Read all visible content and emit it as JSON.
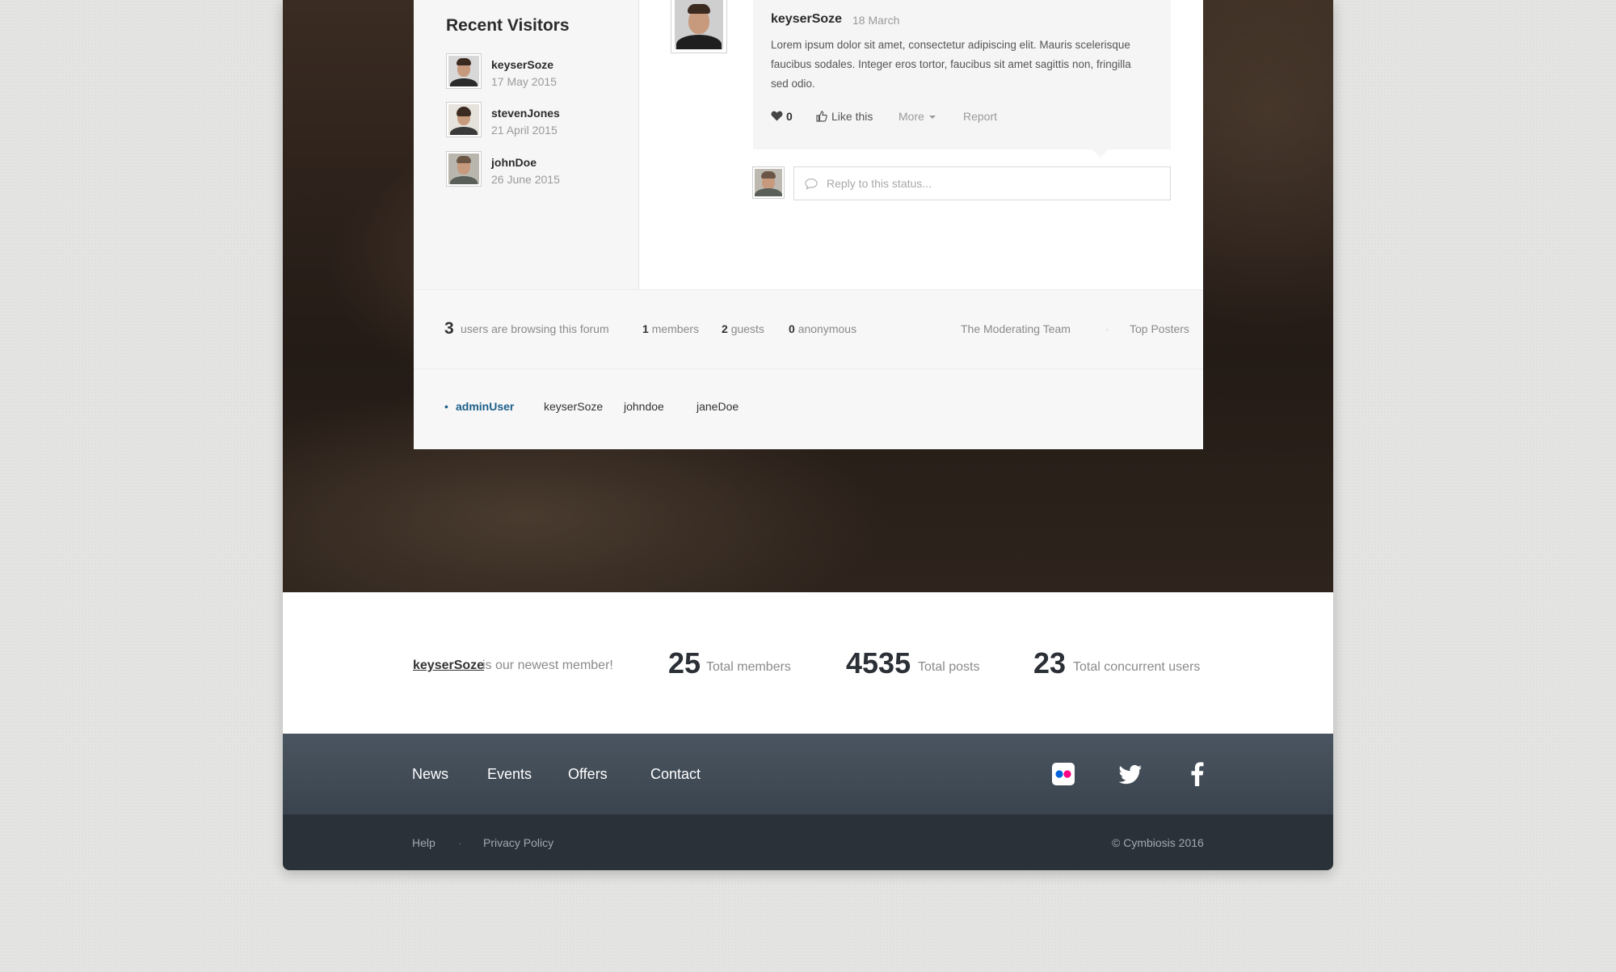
{
  "recent_visitors": {
    "title": "Recent Visitors",
    "items": [
      {
        "name": "keyserSoze",
        "date": "17 May 2015"
      },
      {
        "name": "stevenJones",
        "date": "21 April 2015"
      },
      {
        "name": "johnDoe",
        "date": "26 June 2015"
      }
    ]
  },
  "post": {
    "author": "keyserSoze",
    "date": "18 March",
    "text": "Lorem ipsum dolor sit amet, consectetur adipiscing elit. Mauris scelerisque faucibus sodales. Integer eros tortor, faucibus sit amet sagittis non, fringilla sed odio.",
    "likes": "0",
    "like_label": "Like this",
    "more_label": "More",
    "report_label": "Report",
    "reply_placeholder": "Reply to this status..."
  },
  "online": {
    "count": "3",
    "browsing_text": "users are browsing this forum",
    "members_count": "1",
    "members_label": "members",
    "guests_count": "2",
    "guests_label": "guests",
    "anonymous_count": "0",
    "anonymous_label": "anonymous",
    "moderating_team": "The Moderating Team",
    "separator": "·",
    "top_posters": "Top Posters",
    "bullet": "•",
    "users": [
      "adminUser",
      "keyserSoze",
      "johndoe",
      "janeDoe"
    ]
  },
  "stats": {
    "newest_member": "keyserSoze",
    "newest_text": "is our newest member!",
    "members_value": "25",
    "members_label": "Total members",
    "posts_value": "4535",
    "posts_label": "Total posts",
    "concurrent_value": "23",
    "concurrent_label": "Total concurrent users"
  },
  "footer": {
    "nav": [
      "News",
      "Events",
      "Offers",
      "Contact"
    ],
    "social_icons": [
      "flickr-icon",
      "twitter-icon",
      "facebook-icon"
    ],
    "bottom_links": [
      "Help",
      "Privacy Policy"
    ],
    "separator": "·",
    "copyright": "© Cymbiosis 2016"
  },
  "colors": {
    "accent": "#1d5f8a",
    "footer_top": "#424c57",
    "footer_bottom": "#2a3139"
  }
}
